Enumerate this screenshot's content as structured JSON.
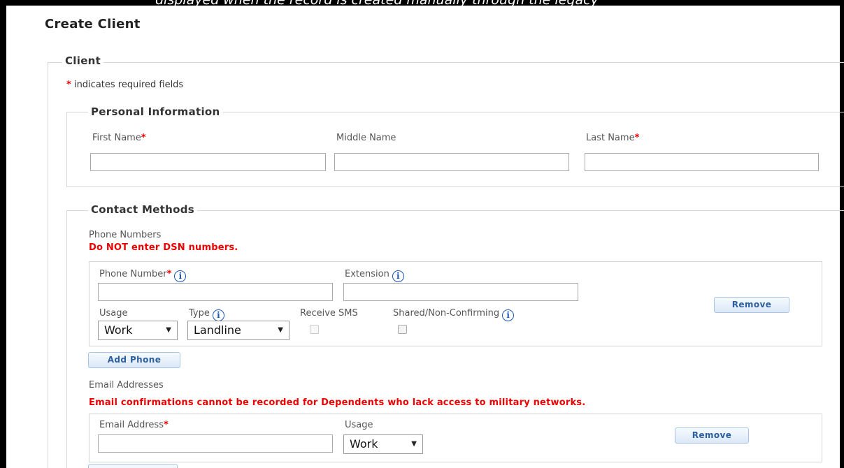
{
  "banner": {
    "text": "displayed when the record is created manually through the legacy"
  },
  "page": {
    "title": "Create Client"
  },
  "client": {
    "legend": "Client",
    "required_mark": "*",
    "required_note": "indicates required fields"
  },
  "personal": {
    "legend": "Personal Information",
    "first_name": {
      "label": "First Name",
      "value": ""
    },
    "middle_name": {
      "label": "Middle Name",
      "value": ""
    },
    "last_name": {
      "label": "Last Name",
      "value": ""
    }
  },
  "contact": {
    "legend": "Contact Methods",
    "phone_section_label": "Phone Numbers",
    "phone_warning": "Do NOT enter DSN numbers.",
    "phone": {
      "number_label": "Phone Number",
      "number_value": "",
      "extension_label": "Extension",
      "extension_value": "",
      "usage_label": "Usage",
      "usage_value": "Work",
      "type_label": "Type",
      "type_value": "Landline",
      "sms_label": "Receive SMS",
      "shared_label": "Shared/Non-Confirming",
      "remove_label": "Remove"
    },
    "add_phone_label": "Add Phone",
    "email_section_label": "Email Addresses",
    "email_warning": "Email confirmations cannot be recorded for Dependents who lack access to military networks.",
    "email": {
      "address_label": "Email Address",
      "address_value": "",
      "usage_label": "Usage",
      "usage_value": "Work",
      "remove_label": "Remove"
    }
  },
  "icons": {
    "info": "i",
    "caret": "▼"
  },
  "colors": {
    "required": "#e00000",
    "button_text": "#2b5f9e",
    "info_icon": "#1a55b3"
  }
}
